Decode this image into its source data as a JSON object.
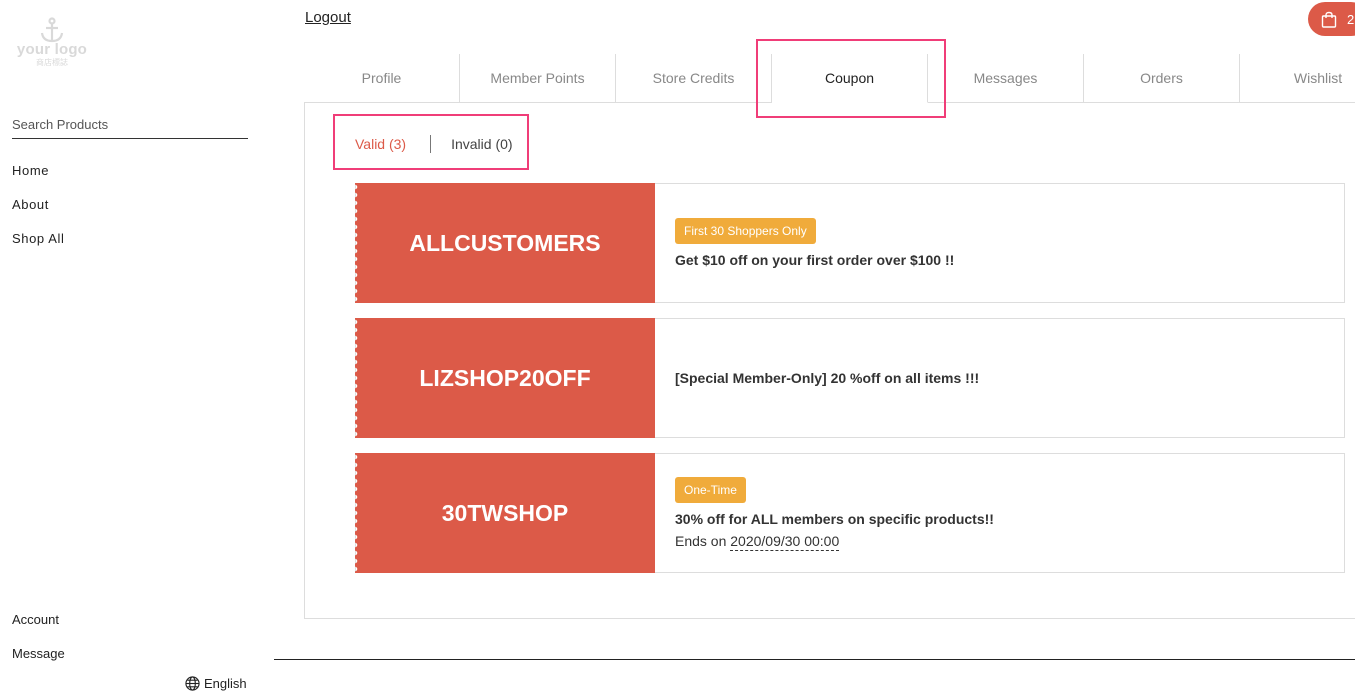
{
  "logo": {
    "text": "your logo",
    "sub": "商店標誌"
  },
  "search": {
    "placeholder": "Search Products"
  },
  "nav": [
    "Home",
    "About",
    "Shop All"
  ],
  "bottom_nav": [
    "Account",
    "Message"
  ],
  "language": "English",
  "header": {
    "logout": "Logout",
    "cart_count": "2"
  },
  "tabs": [
    "Profile",
    "Member Points",
    "Store Credits",
    "Coupon",
    "Messages",
    "Orders",
    "Wishlist"
  ],
  "active_tab": "Coupon",
  "subtabs": {
    "valid": "Valid (3)",
    "invalid": "Invalid (0)"
  },
  "coupons": [
    {
      "code": "ALLCUSTOMERS",
      "badge": "First 30 Shoppers Only",
      "desc": "Get $10 off on your first order over $100 !!"
    },
    {
      "code": "LIZSHOP20OFF",
      "desc": "[Special Member-Only] 20 %off on all items !!!"
    },
    {
      "code": "30TWSHOP",
      "badge": "One-Time",
      "desc": "30% off for ALL members on specific products!!",
      "ends_label": "Ends on",
      "ends_date": "2020/09/30 00:00"
    }
  ],
  "colors": {
    "accent": "#dc5a48",
    "badge": "#f0ab3b",
    "highlight": "#f03d78"
  }
}
